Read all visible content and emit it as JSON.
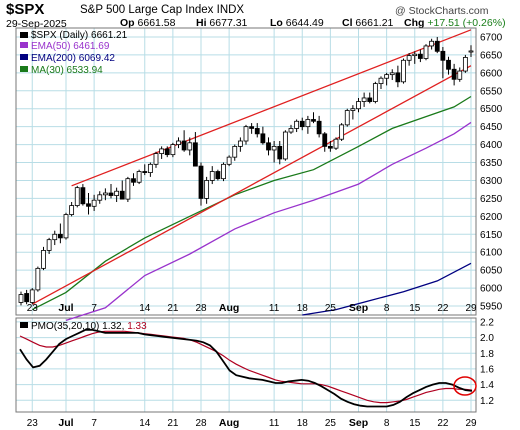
{
  "header": {
    "symbol": "$SPX",
    "name": "S&P 500 Large Cap Index",
    "exchange": "INDX",
    "date": "29-Sep-2025",
    "open_label": "Op",
    "open": "6661.58",
    "high_label": "Hi",
    "high": "6677.31",
    "low_label": "Lo",
    "low": "6644.49",
    "close_label": "Cl",
    "close": "6661.21",
    "change_label": "Chg",
    "change": "+17.51 (+0.26%)",
    "watermark": "@ StockCharts.com"
  },
  "legend": {
    "price": "$SPX (Daily) 6661.21",
    "ema50": "EMA(50) 6461.69",
    "ema200": "EMA(200) 6069.42",
    "ma30": "MA(30) 6533.94",
    "pmo_label": "PMO(35,20,10)",
    "pmo_value": "1.32,",
    "pmo_signal": "1.33"
  },
  "colors": {
    "up": "#ffffff",
    "down": "#000000",
    "channel": "#e02020",
    "ema50": "#9933cc",
    "ema200": "#000080",
    "ma30": "#1a7a1a",
    "pmo": "#000000",
    "pmo_signal": "#b00020",
    "grid": "#b8dde6"
  },
  "chart_data": [
    {
      "type": "candlestick",
      "title": "$SPX (Daily) 6661.21",
      "ylim": [
        5925,
        6725
      ],
      "yticks": [
        5950,
        6000,
        6050,
        6100,
        6150,
        6200,
        6250,
        6300,
        6350,
        6400,
        6450,
        6500,
        6550,
        6600,
        6650,
        6700
      ],
      "xticks": [
        {
          "i": 2,
          "label": "23"
        },
        {
          "i": 8,
          "label": "Jul"
        },
        {
          "i": 13,
          "label": "7"
        },
        {
          "i": 22,
          "label": "14"
        },
        {
          "i": 27,
          "label": "21"
        },
        {
          "i": 32,
          "label": "28"
        },
        {
          "i": 37,
          "label": "Aug"
        },
        {
          "i": 45,
          "label": "11"
        },
        {
          "i": 50,
          "label": "18"
        },
        {
          "i": 55,
          "label": "25"
        },
        {
          "i": 60,
          "label": "Sep"
        },
        {
          "i": 65,
          "label": "8"
        },
        {
          "i": 70,
          "label": "15"
        },
        {
          "i": 75,
          "label": "22"
        },
        {
          "i": 80,
          "label": "29"
        }
      ],
      "candles": [
        [
          5960,
          5990,
          5952,
          5982
        ],
        [
          5985,
          5995,
          5955,
          5962
        ],
        [
          5960,
          6000,
          5955,
          5995
        ],
        [
          5995,
          6060,
          5990,
          6055
        ],
        [
          6055,
          6115,
          6050,
          6105
        ],
        [
          6105,
          6140,
          6095,
          6135
        ],
        [
          6135,
          6160,
          6120,
          6150
        ],
        [
          6150,
          6180,
          6125,
          6140
        ],
        [
          6140,
          6210,
          6135,
          6205
        ],
        [
          6205,
          6240,
          6200,
          6230
        ],
        [
          6230,
          6285,
          6225,
          6280
        ],
        [
          6280,
          6290,
          6230,
          6235
        ],
        [
          6235,
          6265,
          6205,
          6228
        ],
        [
          6228,
          6260,
          6215,
          6245
        ],
        [
          6245,
          6270,
          6235,
          6260
        ],
        [
          6260,
          6278,
          6245,
          6265
        ],
        [
          6265,
          6290,
          6250,
          6258
        ],
        [
          6258,
          6280,
          6240,
          6270
        ],
        [
          6270,
          6300,
          6255,
          6248
        ],
        [
          6248,
          6310,
          6240,
          6305
        ],
        [
          6305,
          6320,
          6285,
          6295
        ],
        [
          6295,
          6330,
          6290,
          6325
        ],
        [
          6325,
          6345,
          6315,
          6322
        ],
        [
          6322,
          6350,
          6310,
          6345
        ],
        [
          6345,
          6380,
          6335,
          6375
        ],
        [
          6375,
          6395,
          6360,
          6388
        ],
        [
          6388,
          6395,
          6365,
          6372
        ],
        [
          6372,
          6405,
          6365,
          6400
        ],
        [
          6400,
          6420,
          6390,
          6410
        ],
        [
          6410,
          6440,
          6380,
          6385
        ],
        [
          6385,
          6420,
          6370,
          6405
        ],
        [
          6405,
          6435,
          6380,
          6340
        ],
        [
          6340,
          6350,
          6230,
          6250
        ],
        [
          6250,
          6310,
          6235,
          6300
        ],
        [
          6300,
          6340,
          6290,
          6325
        ],
        [
          6325,
          6330,
          6300,
          6305
        ],
        [
          6305,
          6350,
          6298,
          6345
        ],
        [
          6345,
          6370,
          6340,
          6365
        ],
        [
          6365,
          6400,
          6355,
          6395
        ],
        [
          6395,
          6420,
          6380,
          6410
        ],
        [
          6410,
          6455,
          6400,
          6450
        ],
        [
          6450,
          6460,
          6430,
          6445
        ],
        [
          6445,
          6460,
          6420,
          6430
        ],
        [
          6430,
          6450,
          6400,
          6405
        ],
        [
          6405,
          6420,
          6370,
          6385
        ],
        [
          6385,
          6410,
          6350,
          6395
        ],
        [
          6395,
          6410,
          6345,
          6360
        ],
        [
          6360,
          6440,
          6355,
          6435
        ],
        [
          6435,
          6455,
          6430,
          6445
        ],
        [
          6445,
          6470,
          6435,
          6465
        ],
        [
          6465,
          6475,
          6440,
          6450
        ],
        [
          6450,
          6480,
          6430,
          6470
        ],
        [
          6470,
          6490,
          6460,
          6465
        ],
        [
          6465,
          6480,
          6420,
          6430
        ],
        [
          6430,
          6435,
          6380,
          6395
        ],
        [
          6395,
          6410,
          6380,
          6390
        ],
        [
          6390,
          6420,
          6385,
          6415
        ],
        [
          6415,
          6460,
          6410,
          6455
        ],
        [
          6455,
          6500,
          6450,
          6495
        ],
        [
          6495,
          6510,
          6470,
          6500
        ],
        [
          6500,
          6530,
          6490,
          6520
        ],
        [
          6520,
          6545,
          6505,
          6530
        ],
        [
          6530,
          6545,
          6515,
          6520
        ],
        [
          6520,
          6575,
          6515,
          6570
        ],
        [
          6570,
          6590,
          6555,
          6585
        ],
        [
          6585,
          6600,
          6565,
          6595
        ],
        [
          6595,
          6610,
          6580,
          6600
        ],
        [
          6600,
          6620,
          6560,
          6575
        ],
        [
          6575,
          6640,
          6570,
          6635
        ],
        [
          6635,
          6655,
          6620,
          6648
        ],
        [
          6648,
          6660,
          6625,
          6652
        ],
        [
          6652,
          6665,
          6630,
          6640
        ],
        [
          6640,
          6680,
          6635,
          6675
        ],
        [
          6675,
          6695,
          6665,
          6688
        ],
        [
          6688,
          6700,
          6655,
          6660
        ],
        [
          6660,
          6672,
          6585,
          6635
        ],
        [
          6635,
          6645,
          6595,
          6610
        ],
        [
          6610,
          6625,
          6565,
          6582
        ],
        [
          6582,
          6615,
          6575,
          6605
        ],
        [
          6605,
          6650,
          6600,
          6643
        ],
        [
          6658,
          6677,
          6644,
          6661
        ]
      ],
      "channel_upper": [
        [
          9,
          6285
        ],
        [
          80,
          6720
        ]
      ],
      "channel_lower": [
        [
          2,
          5955
        ],
        [
          80,
          6620
        ]
      ],
      "ema50": [
        [
          2,
          5940
        ],
        [
          8,
          5990
        ],
        [
          15,
          6070
        ],
        [
          22,
          6140
        ],
        [
          30,
          6205
        ],
        [
          38,
          6255
        ],
        [
          45,
          6295
        ],
        [
          52,
          6335
        ],
        [
          60,
          6385
        ],
        [
          66,
          6440
        ],
        [
          72,
          6475
        ],
        [
          77,
          6500
        ],
        [
          80,
          6525
        ]
      ],
      "ma30": [
        [
          2,
          5940
        ],
        [
          8,
          5988
        ],
        [
          15,
          6075
        ],
        [
          22,
          6140
        ],
        [
          30,
          6200
        ],
        [
          38,
          6260
        ],
        [
          45,
          6300
        ],
        [
          52,
          6330
        ],
        [
          60,
          6395
        ],
        [
          66,
          6445
        ],
        [
          72,
          6478
        ],
        [
          77,
          6505
        ],
        [
          80,
          6534
        ]
      ],
      "ema50_line": [
        [
          8,
          5910
        ],
        [
          15,
          5945
        ],
        [
          22,
          6035
        ],
        [
          30,
          6095
        ],
        [
          38,
          6165
        ],
        [
          45,
          6210
        ],
        [
          52,
          6245
        ],
        [
          60,
          6290
        ],
        [
          66,
          6345
        ],
        [
          72,
          6390
        ],
        [
          77,
          6430
        ],
        [
          80,
          6462
        ]
      ],
      "ema200_line": [
        [
          50,
          5925
        ],
        [
          56,
          5940
        ],
        [
          62,
          5965
        ],
        [
          68,
          5990
        ],
        [
          74,
          6020
        ],
        [
          80,
          6069
        ]
      ]
    },
    {
      "type": "line",
      "title": "PMO(35,20,10)",
      "ylim": [
        1.05,
        2.25
      ],
      "yticks": [
        1.2,
        1.4,
        1.6,
        1.8,
        2.0,
        2.2
      ],
      "series": [
        {
          "name": "PMO",
          "values": [
            1.85,
            1.72,
            1.62,
            1.64,
            1.72,
            1.82,
            1.92,
            1.98,
            2.02,
            2.06,
            2.1,
            2.1,
            2.08,
            2.06,
            2.06,
            2.06,
            2.06,
            2.06,
            2.06,
            2.04,
            2.03,
            2.02,
            2.01,
            2.0,
            1.99,
            1.98,
            1.97,
            1.96,
            1.94,
            1.9,
            1.82,
            1.7,
            1.58,
            1.52,
            1.5,
            1.48,
            1.47,
            1.46,
            1.44,
            1.42,
            1.42,
            1.44,
            1.45,
            1.46,
            1.45,
            1.42,
            1.38,
            1.33,
            1.28,
            1.22,
            1.18,
            1.15,
            1.13,
            1.12,
            1.12,
            1.12,
            1.12,
            1.14,
            1.18,
            1.24,
            1.29,
            1.33,
            1.37,
            1.4,
            1.42,
            1.42,
            1.4,
            1.36,
            1.33,
            1.32
          ]
        },
        {
          "name": "Signal",
          "values": [
            2.02,
            1.98,
            1.94,
            1.9,
            1.88,
            1.88,
            1.9,
            1.93,
            1.96,
            1.99,
            2.02,
            2.05,
            2.07,
            2.08,
            2.08,
            2.08,
            2.08,
            2.07,
            2.06,
            2.05,
            2.04,
            2.03,
            2.02,
            2.01,
            2.0,
            1.99,
            1.97,
            1.94,
            1.9,
            1.86,
            1.82,
            1.77,
            1.71,
            1.66,
            1.62,
            1.58,
            1.55,
            1.52,
            1.49,
            1.46,
            1.44,
            1.43,
            1.42,
            1.41,
            1.41,
            1.41,
            1.4,
            1.38,
            1.35,
            1.32,
            1.29,
            1.26,
            1.23,
            1.2,
            1.18,
            1.17,
            1.17,
            1.18,
            1.19,
            1.21,
            1.24,
            1.27,
            1.3,
            1.32,
            1.34,
            1.35,
            1.35,
            1.34,
            1.34,
            1.33
          ]
        }
      ],
      "highlight": "circle around latest crossover"
    }
  ]
}
